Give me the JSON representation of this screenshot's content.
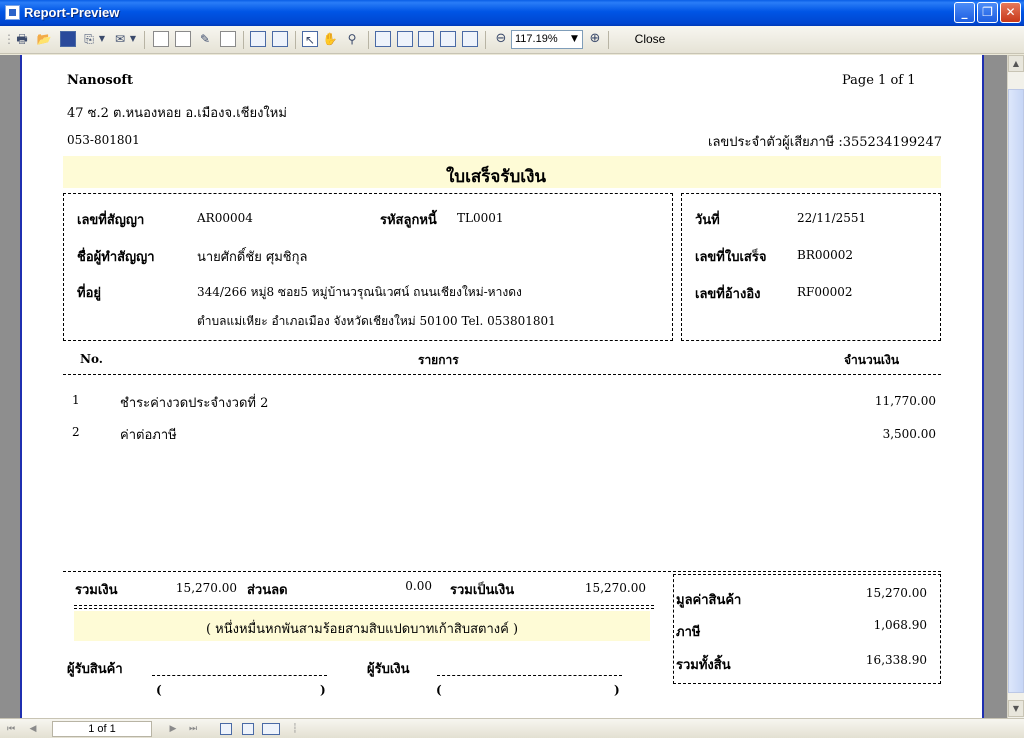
{
  "window": {
    "title": "Report-Preview"
  },
  "toolbar": {
    "zoom": "117.19%",
    "close_label": "Close"
  },
  "navigator": {
    "page_indicator": "1 of 1"
  },
  "report": {
    "company": "Nanosoft",
    "page_info": "Page 1 of 1",
    "address": "47 ซ.2 ต.หนองหอย อ.เมืองจ.เชียงใหม่",
    "phone": "053-801801",
    "tax_id": "เลขประจำตัวผู้เสียภาษี :355234199247",
    "doc_title": "ใบเสร็จรับเงิน",
    "contract_no_label": "เลขที่สัญญา",
    "contract_no": "AR00004",
    "debtor_code_label": "รหัสลูกหนี้",
    "debtor_code": "TL0001",
    "contract_name_label": "ชื่อผู้ทำสัญญา",
    "contract_name": "นายศักดิ์ชัย ศุมชิกุล",
    "address_label": "ที่อยู่",
    "cust_address_1": "344/266 หมู่8 ซอย5 หมู่บ้านวรุณนิเวศน์ ถนนเชียงใหม่-หางดง",
    "cust_address_2": "ตำบลแม่เหียะ อำเภอเมือง จังหวัดเชียงใหม่ 50100 Tel. 053801801",
    "date_label": "วันที่",
    "date": "22/11/2551",
    "receipt_no_label": "เลขที่ใบเสร็จ",
    "receipt_no": "BR00002",
    "ref_no_label": "เลขที่อ้างอิง",
    "ref_no": "RF00002",
    "col_no": "No.",
    "col_item": "รายการ",
    "col_amount": "จำนวนเงิน",
    "items": [
      {
        "no": "1",
        "desc": "ชำระค่างวดประจำงวดที่ 2",
        "amount": "11,770.00"
      },
      {
        "no": "2",
        "desc": "ค่าต่อภาษี",
        "amount": "3,500.00"
      }
    ],
    "total_label": "รวมเงิน",
    "total": "15,270.00",
    "discount_label": "ส่วนลด",
    "discount": "0.00",
    "net_label": "รวมเป็นเงิน",
    "net": "15,270.00",
    "amount_words": "( หนึ่งหมื่นหกพันสามร้อยสามสิบแปดบาทเก้าสิบสตางค์ )",
    "goods_value_label": "มูลค่าสินค้า",
    "goods_value": "15,270.00",
    "tax_label": "ภาษี",
    "tax": "1,068.90",
    "grand_total_label": "รวมทั้งสิ้น",
    "grand_total": "16,338.90",
    "receiver_goods_label": "ผู้รับสินค้า",
    "receiver_money_label": "ผู้รับเงิน",
    "paren_open": "(",
    "paren_close": ")"
  }
}
